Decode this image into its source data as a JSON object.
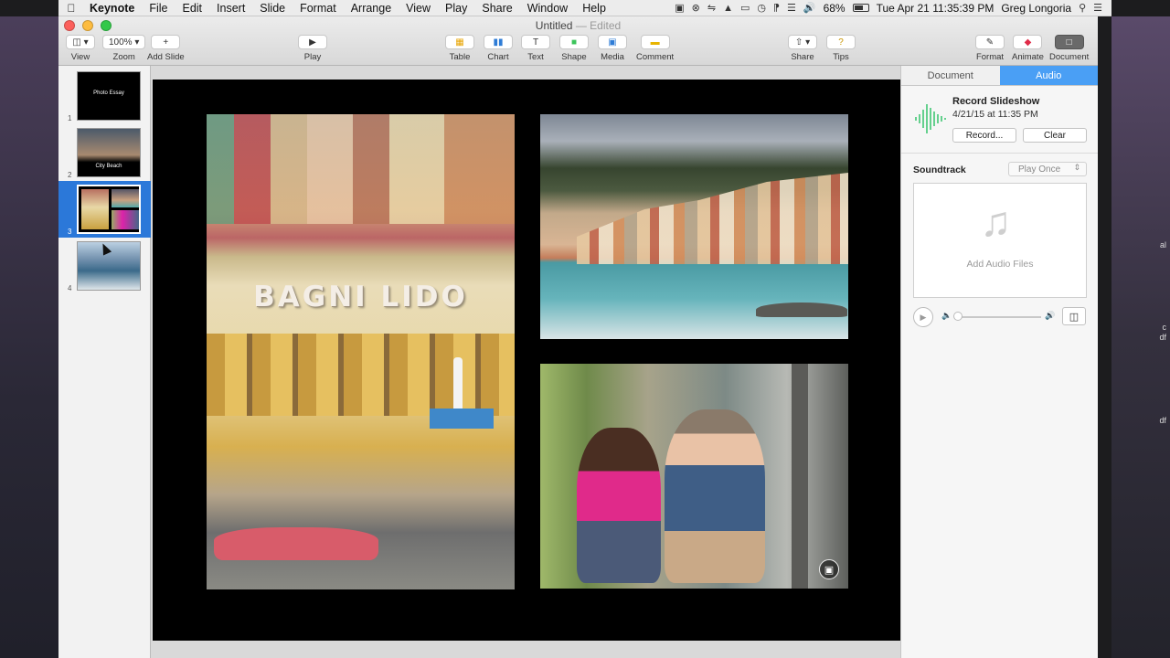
{
  "menubar": {
    "app": "Keynote",
    "items": [
      "File",
      "Edit",
      "Insert",
      "Slide",
      "Format",
      "Arrange",
      "View",
      "Play",
      "Share",
      "Window",
      "Help"
    ],
    "battery": "68%",
    "clock": "Tue Apr 21  11:35:39 PM",
    "user": "Greg Longoria"
  },
  "window": {
    "title": "Untitled",
    "edited": "Edited"
  },
  "toolbar": {
    "view": "View",
    "zoom_value": "100%",
    "zoom": "Zoom",
    "add_slide": "Add Slide",
    "play": "Play",
    "table": "Table",
    "chart": "Chart",
    "text": "Text",
    "shape": "Shape",
    "media": "Media",
    "comment": "Comment",
    "share": "Share",
    "tips": "Tips",
    "format": "Format",
    "animate": "Animate",
    "document": "Document"
  },
  "navigator": {
    "slides": [
      {
        "number": "1",
        "caption": "Photo Essay"
      },
      {
        "number": "2",
        "caption": "City Beach"
      },
      {
        "number": "3",
        "caption": ""
      },
      {
        "number": "4",
        "caption": ""
      }
    ],
    "selected_index": 2
  },
  "slide": {
    "sign_text": "BAGNI LIDO"
  },
  "inspector": {
    "tabs": [
      "Document",
      "Audio"
    ],
    "active_tab": "Audio",
    "record_title": "Record Slideshow",
    "record_date": "4/21/15 at 11:35 PM",
    "record_button": "Record...",
    "clear_button": "Clear",
    "soundtrack_label": "Soundtrack",
    "soundtrack_mode": "Play Once",
    "add_audio": "Add Audio Files",
    "volume": 0
  },
  "icons": {
    "apple": "apple-logo-icon",
    "wifi": "wifi-icon",
    "search": "spotlight-search-icon",
    "note": "music-note-icon"
  },
  "colors": {
    "accent": "#2b78d9",
    "tab_active": "#4a9ff5",
    "waveform": "#35c46b"
  }
}
